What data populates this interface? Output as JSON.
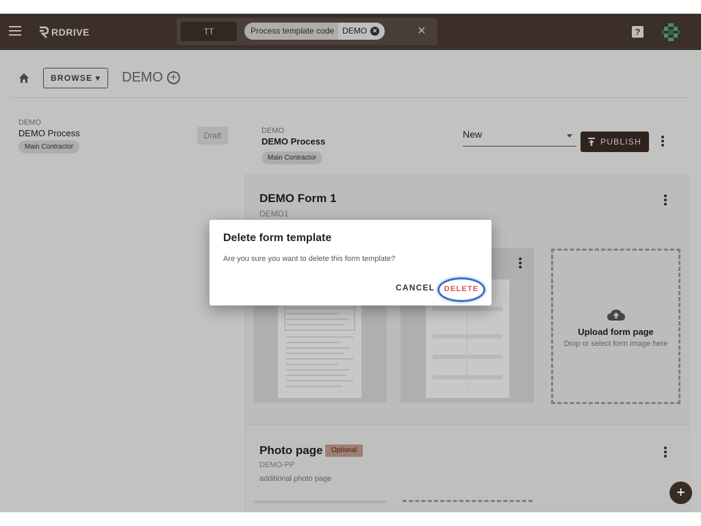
{
  "topbar": {
    "brand": "RDRIVE",
    "tt_label": "TT",
    "filter_label": "Process template code",
    "filter_value": "DEMO",
    "clear_glyph": "×",
    "help_glyph": "?"
  },
  "breadcrumb": {
    "browse_label": "BROWSE ▾",
    "title": "DEMO",
    "add_glyph": "+"
  },
  "left": {
    "code": "DEMO",
    "name": "DEMO Process",
    "tag": "Main Contractor",
    "status": "Draft"
  },
  "process": {
    "code": "DEMO",
    "name": "DEMO Process",
    "tag": "Main Contractor",
    "status_value": "New",
    "publish_label": "PUBLISH"
  },
  "form": {
    "title": "DEMO Form 1",
    "code": "DEMO1",
    "upload_title": "Upload form page",
    "upload_hint": "Drop or select form image here"
  },
  "photo": {
    "title": "Photo page",
    "badge": "Optional",
    "code": "DEMO-PP",
    "description": "additional photo page"
  },
  "fab_glyph": "+",
  "dialog": {
    "title": "Delete form template",
    "message": "Are you sure you want to delete this form template?",
    "cancel_label": "CANCEL",
    "delete_label": "DELETE"
  },
  "colors": {
    "topbar": "#4a3a33",
    "primary": "#3b2b25",
    "danger": "#e05050",
    "highlight": "#3e6fc8"
  }
}
